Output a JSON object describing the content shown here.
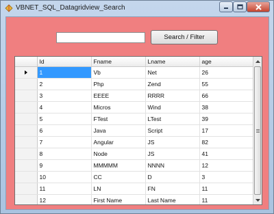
{
  "window": {
    "title": "VBNET_SQL_Datagridview_Search",
    "icons": {
      "app": "app-icon",
      "minimize": "minimize-icon",
      "maximize": "maximize-icon",
      "close": "close-icon"
    },
    "colors": {
      "client_background": "#f07f80",
      "selection": "#3399ff",
      "close_button": "#c5442f"
    }
  },
  "search": {
    "value": "",
    "button_label": "Search / Filter"
  },
  "grid": {
    "columns": [
      "Id",
      "Fname",
      "Lname",
      "age"
    ],
    "current_row_icon": "current-row-arrow-icon",
    "selected_cell": {
      "row": 0,
      "column": "Id"
    },
    "rows": [
      [
        "1",
        "Vb",
        "Net",
        "26"
      ],
      [
        "2",
        "Php",
        "Zend",
        "55"
      ],
      [
        "3",
        "EEEE",
        "RRRR",
        "66"
      ],
      [
        "4",
        "Micros",
        "Wind",
        "38"
      ],
      [
        "5",
        "FTest",
        "LTest",
        "39"
      ],
      [
        "6",
        "Java",
        "Script",
        "17"
      ],
      [
        "7",
        "Angular",
        "JS",
        "82"
      ],
      [
        "8",
        "Node",
        "JS",
        "41"
      ],
      [
        "9",
        "MMMMM",
        "NNNN",
        "12"
      ],
      [
        "10",
        "CC",
        "D",
        "3"
      ],
      [
        "11",
        "LN",
        "FN",
        "11"
      ],
      [
        "12",
        "First Name",
        "Last Name",
        "11"
      ]
    ]
  }
}
